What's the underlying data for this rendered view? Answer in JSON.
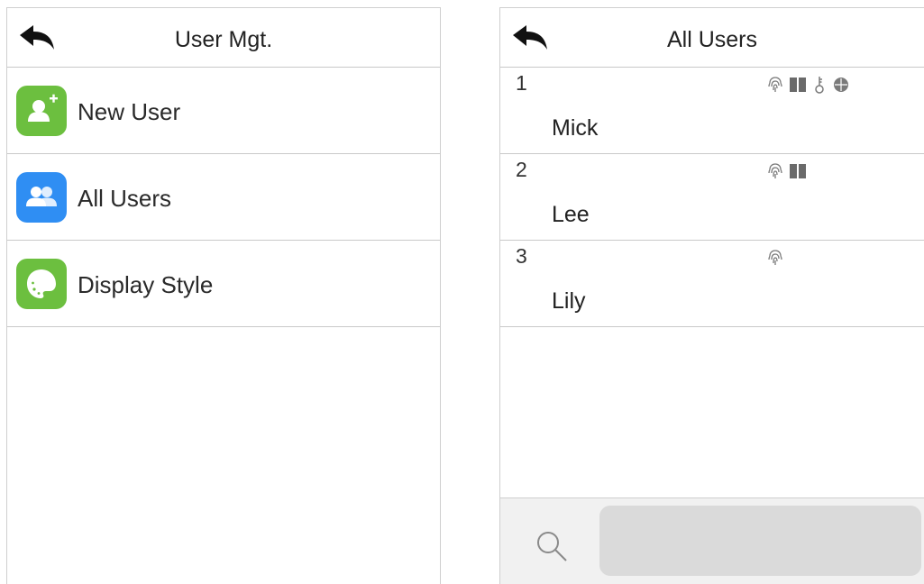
{
  "user_mgt": {
    "title": "User Mgt.",
    "items": [
      {
        "label": "New User",
        "icon": "add-user-icon",
        "color": "#6cbf3f"
      },
      {
        "label": "All Users",
        "icon": "users-group-icon",
        "color": "#2f8ef3"
      },
      {
        "label": "Display Style",
        "icon": "palette-icon",
        "color": "#6cbf3f"
      }
    ]
  },
  "all_users": {
    "title": "All Users",
    "users": [
      {
        "id": "1",
        "name": "Mick",
        "credentials": [
          "fingerprint-icon",
          "card-icon",
          "password-icon",
          "face-icon"
        ]
      },
      {
        "id": "2",
        "name": "Lee",
        "credentials": [
          "fingerprint-icon",
          "card-icon"
        ]
      },
      {
        "id": "3",
        "name": "Lily",
        "credentials": [
          "fingerprint-icon"
        ]
      }
    ],
    "search": {
      "value": "",
      "placeholder": ""
    }
  },
  "colors": {
    "green": "#6cbf3f",
    "blue": "#2f8ef3",
    "divider": "#c9c9c9",
    "search_bg": "#dadada"
  }
}
